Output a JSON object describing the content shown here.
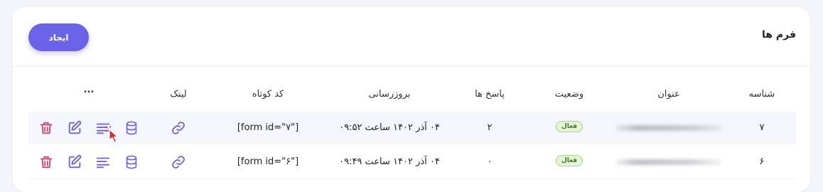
{
  "header": {
    "title": "فرم ها",
    "create_label": "ایجاد"
  },
  "table": {
    "columns": {
      "id": "شناسه",
      "title": "عنوان",
      "status": "وضعیت",
      "responses": "پاسخ ها",
      "updated": "بروزرسانی",
      "shortcode": "کد کوتاه",
      "link": "لینک",
      "more": "..."
    },
    "rows": [
      {
        "id": "۷",
        "status": "فعال",
        "responses": "۲",
        "updated": "۰۴ آذر ۱۴۰۲ ساعت ۰۹:۵۲",
        "shortcode": "[form id=\"۷\"]"
      },
      {
        "id": "۶",
        "status": "فعال",
        "responses": "۰",
        "updated": "۰۴ آذر ۱۴۰۲ ساعت ۰۹:۴۹",
        "shortcode": "[form id=\"۶\"]"
      }
    ]
  },
  "icons": {
    "link": "link-icon",
    "database": "database-icon",
    "lines": "list-lines-icon",
    "edit": "edit-icon",
    "delete": "trash-icon"
  },
  "colors": {
    "accent": "#6a63e8",
    "icon_purple": "#6c63d9",
    "danger": "#c9476e",
    "badge_bg": "#e3f4d8",
    "badge_text": "#3e7a22",
    "cursor": "#d6263a"
  }
}
